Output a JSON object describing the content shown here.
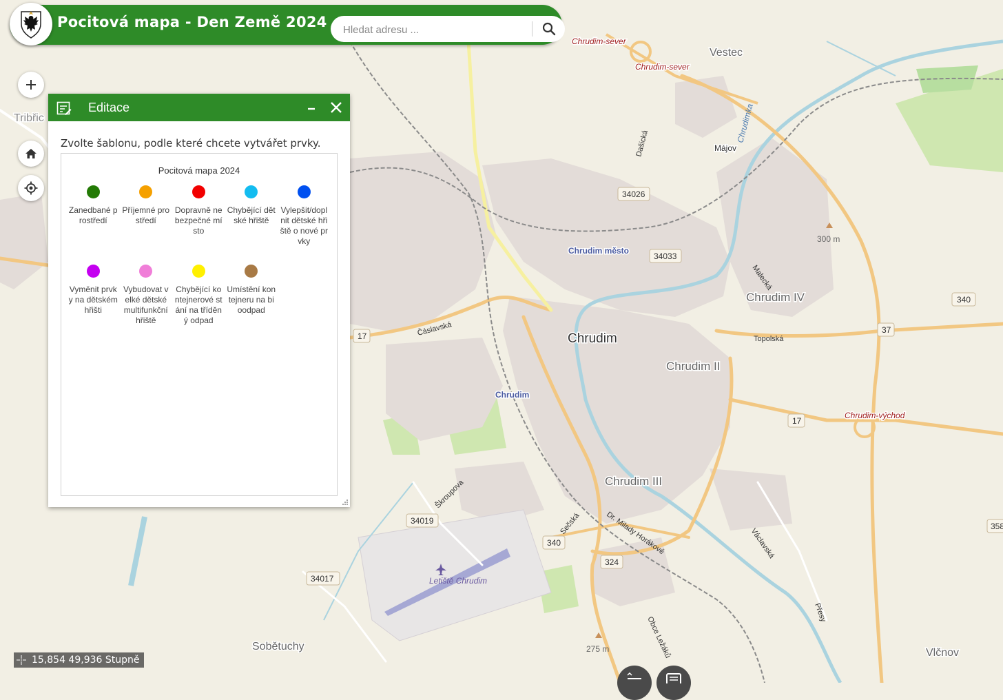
{
  "header": {
    "title": "Pocitová mapa - Den Země 2024",
    "search_placeholder": "Hledat adresu ..."
  },
  "panel": {
    "title": "Editace",
    "instruction": "Zvolte šablonu, podle které chcete vytvářet prvky.",
    "group_title": "Pocitová mapa 2024",
    "templates": [
      {
        "label": "Zanedbané prostředí",
        "color": "#237a05"
      },
      {
        "label": "Příjemné prostředí",
        "color": "#f5a000"
      },
      {
        "label": "Dopravně nebezpečné místo",
        "color": "#f20000"
      },
      {
        "label": "Chybějící dětské hřiště",
        "color": "#13bcf0"
      },
      {
        "label": "Vylepšit/doplnit dětské hřiště o nové prvky",
        "color": "#0050f0"
      },
      {
        "label": "Vyměnit prvky na dětském hřišti",
        "color": "#c400f0"
      },
      {
        "label": "Vybudovat velké dětské multifunkční hřiště",
        "color": "#f07ed8"
      },
      {
        "label": "Chybějící kontejnerové stání na tříděný odpad",
        "color": "#fff000"
      },
      {
        "label": "Umístění kontejneru na bioodpad",
        "color": "#a87a45"
      }
    ]
  },
  "coordinates": "15,854 49,936 Stupně",
  "map_labels": {
    "city": "Chrudim",
    "chrudim_ii": "Chrudim II",
    "chrudim_iii": "Chrudim III",
    "chrudim_iv": "Chrudim IV",
    "chrudim_mesto": "Chrudim město",
    "chrudim_station": "Chrudim",
    "vestec": "Vestec",
    "majov": "Májov",
    "tribric": "Tribřic",
    "sobetuchy": "Sobětuchy",
    "vlcnov": "Vlčnov",
    "exit_sever": "Chrudim-sever",
    "exit_vychod": "Chrudim-východ",
    "airport": "Letiště Chrudim",
    "caslavska": "Čáslavská",
    "topolska": "Topolská",
    "skroupova": "Škroupova",
    "secska": "Sečská",
    "horakove": "Dr. Milady Horákové",
    "vaclavska": "Václavská",
    "malecka": "Malecká",
    "dasicka": "Dašická",
    "chrudimka": "Chrudimka",
    "obce_lezaku": "Obce Ležáků",
    "presy": "Přesy",
    "peak_300": "300 m",
    "peak_275": "275 m",
    "shield_34026": "34026",
    "shield_34033": "34033",
    "shield_340a": "340",
    "shield_340b": "340",
    "shield_37": "37",
    "shield_17a": "17",
    "shield_17b": "17",
    "shield_34019": "34019",
    "shield_34017": "34017",
    "shield_324": "324",
    "shield_358": "358"
  }
}
